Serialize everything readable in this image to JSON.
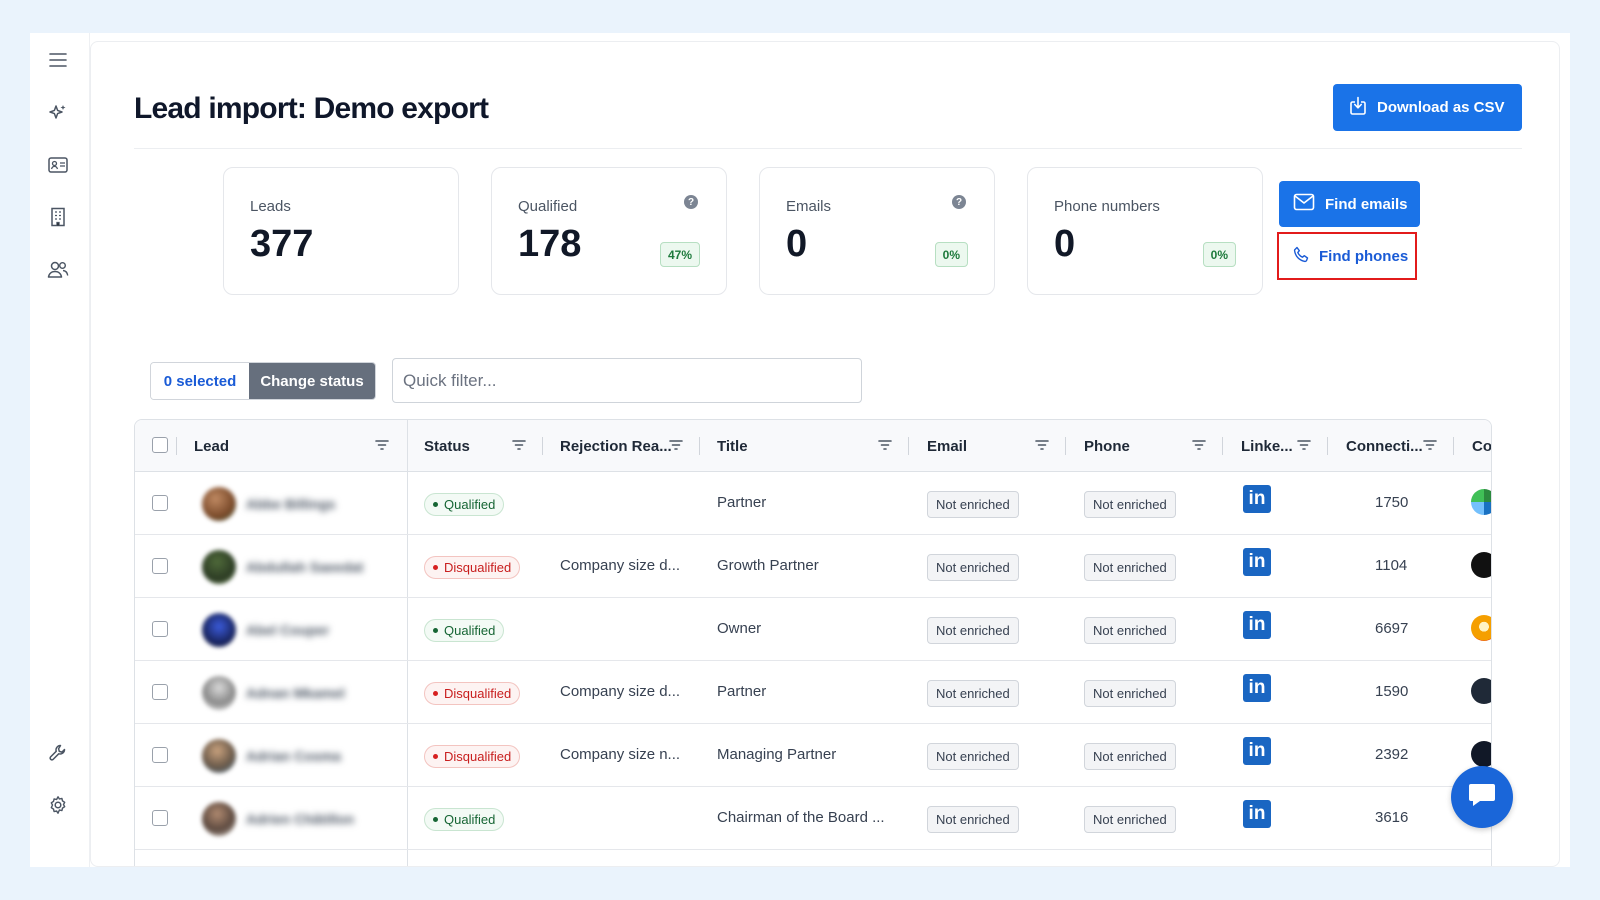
{
  "page": {
    "title": "Lead import: Demo export",
    "download_label": "Download as CSV"
  },
  "sidebar": {
    "icons": [
      "menu-icon",
      "sparkles-icon",
      "contact-card-icon",
      "building-icon",
      "users-icon",
      "wrench-icon",
      "gear-icon"
    ]
  },
  "stats": {
    "leads": {
      "label": "Leads",
      "value": "377"
    },
    "qualified": {
      "label": "Qualified",
      "value": "178",
      "percent": "47%"
    },
    "emails": {
      "label": "Emails",
      "value": "0",
      "percent": "0%"
    },
    "phones": {
      "label": "Phone numbers",
      "value": "0",
      "percent": "0%"
    }
  },
  "actions": {
    "find_emails": "Find emails",
    "find_phones": "Find phones"
  },
  "toolbar": {
    "selected": "0 selected",
    "change_status": "Change status",
    "quick_filter_placeholder": "Quick filter..."
  },
  "columns": [
    "Lead",
    "Status",
    "Rejection Rea...",
    "Title",
    "Email",
    "Phone",
    "Linke...",
    "Connecti...",
    "Co"
  ],
  "rows": [
    {
      "name": "Abbe Billings",
      "status": "Qualified",
      "rejection": "",
      "title": "Partner",
      "email": "Not enriched",
      "phone": "Not enriched",
      "linkedin": "in",
      "connections": "1750"
    },
    {
      "name": "Abdullah Saeedat",
      "status": "Disqualified",
      "rejection": "Company size d...",
      "title": "Growth Partner",
      "email": "Not enriched",
      "phone": "Not enriched",
      "linkedin": "in",
      "connections": "1104"
    },
    {
      "name": "Abel Couper",
      "status": "Qualified",
      "rejection": "",
      "title": "Owner",
      "email": "Not enriched",
      "phone": "Not enriched",
      "linkedin": "in",
      "connections": "6697"
    },
    {
      "name": "Adnan Mkamel",
      "status": "Disqualified",
      "rejection": "Company size d...",
      "title": "Partner",
      "email": "Not enriched",
      "phone": "Not enriched",
      "linkedin": "in",
      "connections": "1590"
    },
    {
      "name": "Adrian Cosma",
      "status": "Disqualified",
      "rejection": "Company size n...",
      "title": "Managing Partner",
      "email": "Not enriched",
      "phone": "Not enriched",
      "linkedin": "in",
      "connections": "2392"
    },
    {
      "name": "Adrien Châtillon",
      "status": "Qualified",
      "rejection": "",
      "title": "Chairman of the Board ...",
      "email": "Not enriched",
      "phone": "Not enriched",
      "linkedin": "in",
      "connections": "3616"
    }
  ],
  "colors": {
    "primary": "#1a73e8",
    "highlight_border": "#e21b1b",
    "qualified": "#166534",
    "disqualified": "#c81e1e",
    "linkedin": "#1a66c2"
  }
}
